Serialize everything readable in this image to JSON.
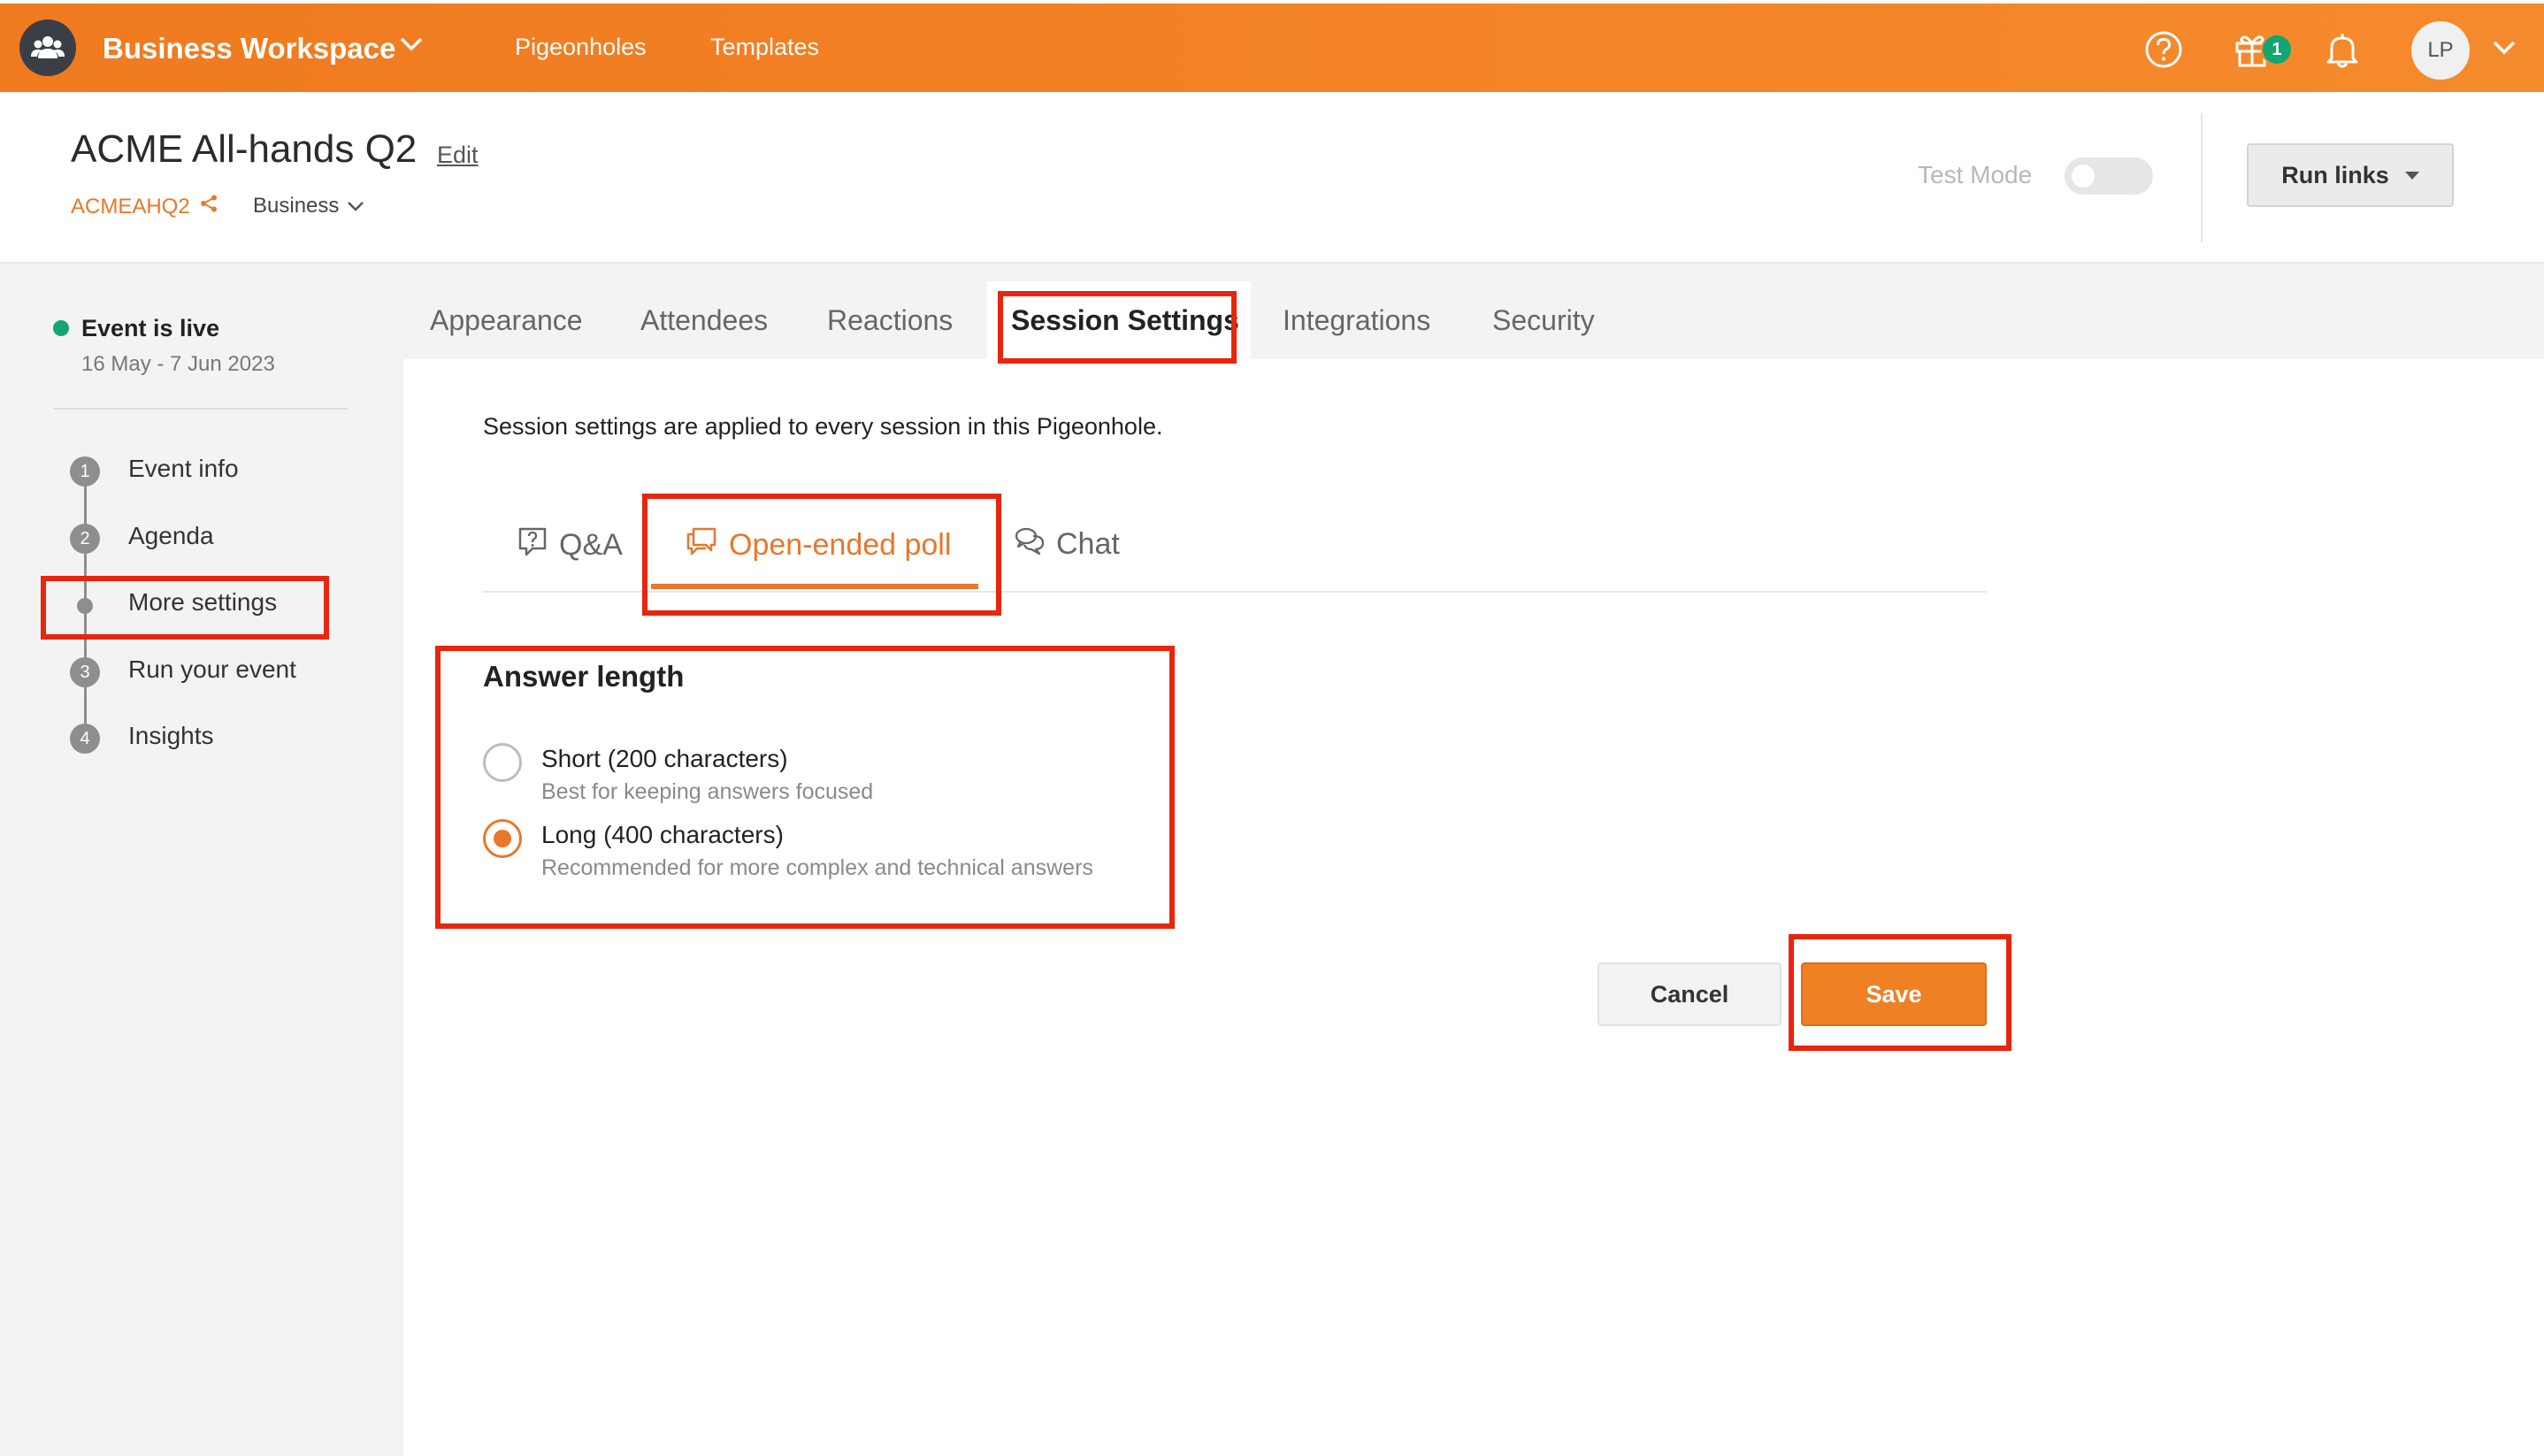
{
  "topbar": {
    "workspace_name": "Business Workspace",
    "nav": [
      "Pigeonholes",
      "Templates"
    ],
    "gift_badge_count": "1",
    "avatar_initials": "LP",
    "icons": [
      "workspace-users-icon",
      "help-icon",
      "gift-icon",
      "bell-icon",
      "chevron-down-icon"
    ]
  },
  "event": {
    "title": "ACME All-hands Q2",
    "edit_label": "Edit",
    "code": "ACMEAHQ2",
    "type": "Business",
    "test_mode_label": "Test Mode",
    "test_mode_on": false,
    "run_links_label": "Run links"
  },
  "sidebar": {
    "status": "Event is live",
    "dates": "16 May - 7 Jun 2023",
    "steps": [
      {
        "num": "1",
        "label": "Event info"
      },
      {
        "num": "2",
        "label": "Agenda"
      },
      {
        "num": "",
        "label": "More settings"
      },
      {
        "num": "3",
        "label": "Run your event"
      },
      {
        "num": "4",
        "label": "Insights"
      }
    ]
  },
  "tabs": [
    "Appearance",
    "Attendees",
    "Reactions",
    "Session Settings",
    "Integrations",
    "Security"
  ],
  "active_tab": "Session Settings",
  "content": {
    "description": "Session settings are applied to every session in this Pigeonhole.",
    "subtabs": [
      "Q&A",
      "Open-ended poll",
      "Chat"
    ],
    "active_subtab": "Open-ended poll",
    "section_title": "Answer length",
    "options": [
      {
        "title": "Short (200 characters)",
        "desc": "Best for keeping answers focused",
        "selected": false
      },
      {
        "title": "Long (400 characters)",
        "desc": "Recommended for more complex and technical answers",
        "selected": true
      }
    ],
    "cancel_label": "Cancel",
    "save_label": "Save"
  },
  "colors": {
    "brand_orange": "#f58a2c",
    "accent_orange": "#e8772a",
    "live_green": "#13a572",
    "highlight_red": "#e8250f"
  }
}
